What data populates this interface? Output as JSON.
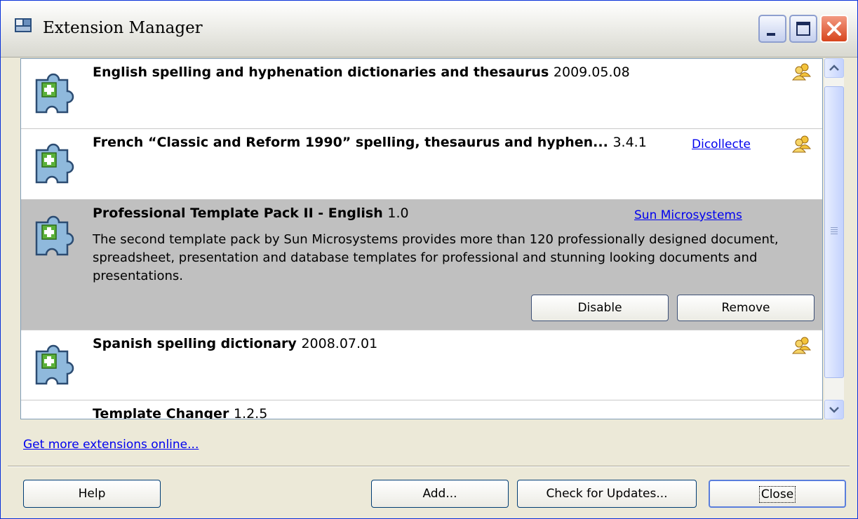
{
  "window": {
    "title": "Extension Manager"
  },
  "extensions": [
    {
      "name": "English spelling and hyphenation dictionaries and thesaurus",
      "version": "2009.05.08",
      "link": ""
    },
    {
      "name": "French “Classic and Reform 1990” spelling, thesaurus and hyphen...",
      "version": "3.4.1",
      "link": "Dicollecte"
    },
    {
      "name": "Professional Template Pack II - English",
      "version": "1.0",
      "link": "Sun Microsystems",
      "description": "The second template pack by Sun Microsystems provides more than 120 professionally designed document, spreadsheet, presentation and database templates for professional and stunning looking documents and presentations.",
      "disable_label": "Disable",
      "remove_label": "Remove"
    },
    {
      "name": "Spanish spelling dictionary",
      "version": "2008.07.01",
      "link": ""
    },
    {
      "name": "Template Changer",
      "version": "1.2.5",
      "link": ""
    }
  ],
  "get_more_link": "Get more extensions online...",
  "buttons": {
    "help": "Help",
    "add": "Add...",
    "check_updates": "Check for Updates...",
    "close": "Close"
  },
  "icons": {
    "extension": "puzzle-piece-icon",
    "shared": "shared-users-icon"
  },
  "colors": {
    "selected_row": "#c0c0c0",
    "link": "#0000ee",
    "close_button": "#d7451d"
  }
}
